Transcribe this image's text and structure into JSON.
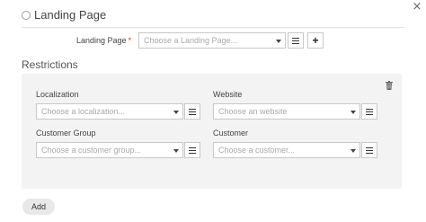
{
  "header": {
    "close_symbol": "×"
  },
  "landing_page_option": {
    "radio_label": "Landing Page"
  },
  "landing_page_field": {
    "label": "Landing Page",
    "required_mark": "*",
    "placeholder": "Choose a Landing Page..."
  },
  "restrictions": {
    "title": "Restrictions",
    "localization": {
      "label": "Localization",
      "placeholder": "Choose a localization..."
    },
    "website": {
      "label": "Website",
      "placeholder": "Choose an website"
    },
    "customer_group": {
      "label": "Customer Group",
      "placeholder": "Choose a customer group..."
    },
    "customer": {
      "label": "Customer",
      "placeholder": "Choose a customer..."
    }
  },
  "actions": {
    "add_label": "Add"
  },
  "colors": {
    "required": "#c0392b",
    "box_bg": "#f3f3f3"
  },
  "icons": [
    "close-icon",
    "radio-icon",
    "list-icon",
    "plus-icon",
    "trash-icon",
    "caret-down-icon"
  ]
}
